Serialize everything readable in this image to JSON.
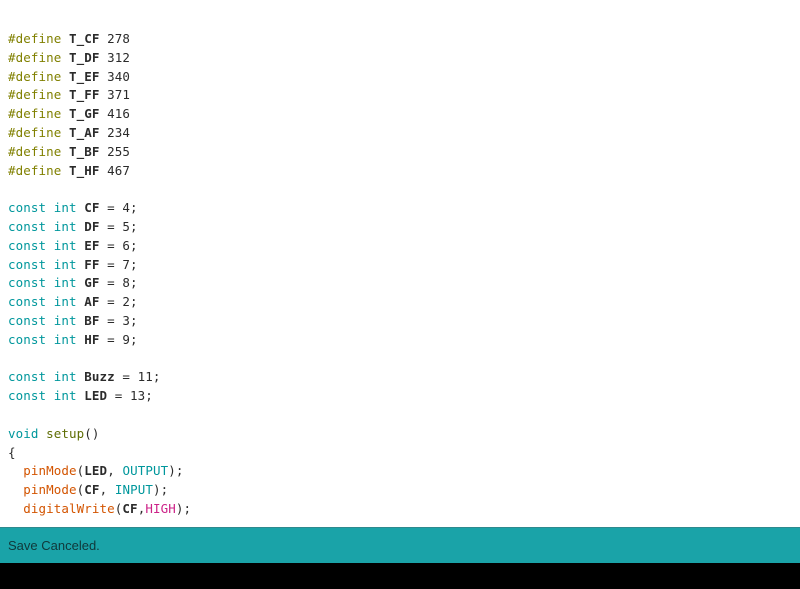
{
  "editor": {
    "background": "#ffffff",
    "font_size_px": 12.5,
    "code_lines": [
      {
        "id": "define-t-cf",
        "text": "#define T_CF 278",
        "tokens": [
          {
            "t": "#define",
            "c": "tok-preproc"
          },
          {
            "t": " ",
            "c": "tok-plain"
          },
          {
            "t": "T_CF",
            "c": "tok-ident"
          },
          {
            "t": " 278",
            "c": "tok-plain"
          }
        ]
      },
      {
        "id": "define-t-df",
        "text": "#define T_DF 312",
        "tokens": [
          {
            "t": "#define",
            "c": "tok-preproc"
          },
          {
            "t": " ",
            "c": "tok-plain"
          },
          {
            "t": "T_DF",
            "c": "tok-ident"
          },
          {
            "t": " 312",
            "c": "tok-plain"
          }
        ]
      },
      {
        "id": "define-t-ef",
        "text": "#define T_EF 340",
        "tokens": [
          {
            "t": "#define",
            "c": "tok-preproc"
          },
          {
            "t": " ",
            "c": "tok-plain"
          },
          {
            "t": "T_EF",
            "c": "tok-ident"
          },
          {
            "t": " 340",
            "c": "tok-plain"
          }
        ]
      },
      {
        "id": "define-t-ff",
        "text": "#define T_FF 371",
        "tokens": [
          {
            "t": "#define",
            "c": "tok-preproc"
          },
          {
            "t": " ",
            "c": "tok-plain"
          },
          {
            "t": "T_FF",
            "c": "tok-ident"
          },
          {
            "t": " 371",
            "c": "tok-plain"
          }
        ]
      },
      {
        "id": "define-t-gf",
        "text": "#define T_GF 416",
        "tokens": [
          {
            "t": "#define",
            "c": "tok-preproc"
          },
          {
            "t": " ",
            "c": "tok-plain"
          },
          {
            "t": "T_GF",
            "c": "tok-ident"
          },
          {
            "t": " 416",
            "c": "tok-plain"
          }
        ]
      },
      {
        "id": "define-t-af",
        "text": "#define T_AF 234",
        "tokens": [
          {
            "t": "#define",
            "c": "tok-preproc"
          },
          {
            "t": " ",
            "c": "tok-plain"
          },
          {
            "t": "T_AF",
            "c": "tok-ident"
          },
          {
            "t": " 234",
            "c": "tok-plain"
          }
        ]
      },
      {
        "id": "define-t-bf",
        "text": "#define T_BF 255",
        "tokens": [
          {
            "t": "#define",
            "c": "tok-preproc"
          },
          {
            "t": " ",
            "c": "tok-plain"
          },
          {
            "t": "T_BF",
            "c": "tok-ident"
          },
          {
            "t": " 255",
            "c": "tok-plain"
          }
        ]
      },
      {
        "id": "define-t-hf",
        "text": "#define T_HF 467",
        "tokens": [
          {
            "t": "#define",
            "c": "tok-preproc"
          },
          {
            "t": " ",
            "c": "tok-plain"
          },
          {
            "t": "T_HF",
            "c": "tok-ident"
          },
          {
            "t": " 467",
            "c": "tok-plain"
          }
        ]
      },
      {
        "id": "blank-1",
        "text": "",
        "tokens": []
      },
      {
        "id": "const-cf",
        "text": "const int CF = 4;",
        "tokens": [
          {
            "t": "const int",
            "c": "tok-keyword"
          },
          {
            "t": " ",
            "c": "tok-plain"
          },
          {
            "t": "CF",
            "c": "tok-ident"
          },
          {
            "t": " = 4;",
            "c": "tok-plain"
          }
        ]
      },
      {
        "id": "const-df",
        "text": "const int DF = 5;",
        "tokens": [
          {
            "t": "const int",
            "c": "tok-keyword"
          },
          {
            "t": " ",
            "c": "tok-plain"
          },
          {
            "t": "DF",
            "c": "tok-ident"
          },
          {
            "t": " = 5;",
            "c": "tok-plain"
          }
        ]
      },
      {
        "id": "const-ef",
        "text": "const int EF = 6;",
        "tokens": [
          {
            "t": "const int",
            "c": "tok-keyword"
          },
          {
            "t": " ",
            "c": "tok-plain"
          },
          {
            "t": "EF",
            "c": "tok-ident"
          },
          {
            "t": " = 6;",
            "c": "tok-plain"
          }
        ]
      },
      {
        "id": "const-ff",
        "text": "const int FF = 7;",
        "tokens": [
          {
            "t": "const int",
            "c": "tok-keyword"
          },
          {
            "t": " ",
            "c": "tok-plain"
          },
          {
            "t": "FF",
            "c": "tok-ident"
          },
          {
            "t": " = 7;",
            "c": "tok-plain"
          }
        ]
      },
      {
        "id": "const-gf",
        "text": "const int GF = 8;",
        "tokens": [
          {
            "t": "const int",
            "c": "tok-keyword"
          },
          {
            "t": " ",
            "c": "tok-plain"
          },
          {
            "t": "GF",
            "c": "tok-ident"
          },
          {
            "t": " = 8;",
            "c": "tok-plain"
          }
        ]
      },
      {
        "id": "const-af",
        "text": "const int AF = 2;",
        "tokens": [
          {
            "t": "const int",
            "c": "tok-keyword"
          },
          {
            "t": " ",
            "c": "tok-plain"
          },
          {
            "t": "AF",
            "c": "tok-ident"
          },
          {
            "t": " = 2;",
            "c": "tok-plain"
          }
        ]
      },
      {
        "id": "const-bf",
        "text": "const int BF = 3;",
        "tokens": [
          {
            "t": "const int",
            "c": "tok-keyword"
          },
          {
            "t": " ",
            "c": "tok-plain"
          },
          {
            "t": "BF",
            "c": "tok-ident"
          },
          {
            "t": " = 3;",
            "c": "tok-plain"
          }
        ]
      },
      {
        "id": "const-hf",
        "text": "const int HF = 9;",
        "tokens": [
          {
            "t": "const int",
            "c": "tok-keyword"
          },
          {
            "t": " ",
            "c": "tok-plain"
          },
          {
            "t": "HF",
            "c": "tok-ident"
          },
          {
            "t": " = 9;",
            "c": "tok-plain"
          }
        ]
      },
      {
        "id": "blank-2",
        "text": "",
        "tokens": []
      },
      {
        "id": "const-buzz",
        "text": "const int Buzz = 11;",
        "tokens": [
          {
            "t": "const int",
            "c": "tok-keyword"
          },
          {
            "t": " ",
            "c": "tok-plain"
          },
          {
            "t": "Buzz",
            "c": "tok-ident"
          },
          {
            "t": " = 11;",
            "c": "tok-plain"
          }
        ]
      },
      {
        "id": "const-led",
        "text": "const int LED = 13;",
        "tokens": [
          {
            "t": "const int",
            "c": "tok-keyword"
          },
          {
            "t": " ",
            "c": "tok-plain"
          },
          {
            "t": "LED",
            "c": "tok-ident"
          },
          {
            "t": " = 13;",
            "c": "tok-plain"
          }
        ]
      },
      {
        "id": "blank-3",
        "text": "",
        "tokens": []
      },
      {
        "id": "setup-signature",
        "text": "void setup()",
        "tokens": [
          {
            "t": "void",
            "c": "tok-keyword"
          },
          {
            "t": " ",
            "c": "tok-plain"
          },
          {
            "t": "setup",
            "c": "tok-setupname"
          },
          {
            "t": "()",
            "c": "tok-punct"
          }
        ]
      },
      {
        "id": "setup-open-brace",
        "text": "{",
        "tokens": [
          {
            "t": "{",
            "c": "tok-punct"
          }
        ]
      },
      {
        "id": "pinmode-led-output",
        "text": "  pinMode(LED, OUTPUT);",
        "tokens": [
          {
            "t": "  ",
            "c": "tok-plain"
          },
          {
            "t": "pinMode",
            "c": "tok-func"
          },
          {
            "t": "(",
            "c": "tok-punct"
          },
          {
            "t": "LED",
            "c": "tok-ident"
          },
          {
            "t": ", ",
            "c": "tok-plain"
          },
          {
            "t": "OUTPUT",
            "c": "tok-const"
          },
          {
            "t": ");",
            "c": "tok-punct"
          }
        ]
      },
      {
        "id": "pinmode-cf-input",
        "text": "  pinMode(CF, INPUT);",
        "tokens": [
          {
            "t": "  ",
            "c": "tok-plain"
          },
          {
            "t": "pinMode",
            "c": "tok-func"
          },
          {
            "t": "(",
            "c": "tok-punct"
          },
          {
            "t": "CF",
            "c": "tok-ident"
          },
          {
            "t": ", ",
            "c": "tok-plain"
          },
          {
            "t": "INPUT",
            "c": "tok-const"
          },
          {
            "t": ");",
            "c": "tok-punct"
          }
        ]
      },
      {
        "id": "digitalwrite-cf-high",
        "text": "  digitalWrite(CF,HIGH);",
        "tokens": [
          {
            "t": "  ",
            "c": "tok-plain"
          },
          {
            "t": "digitalWrite",
            "c": "tok-func"
          },
          {
            "t": "(",
            "c": "tok-punct"
          },
          {
            "t": "CF",
            "c": "tok-ident"
          },
          {
            "t": ",",
            "c": "tok-plain"
          },
          {
            "t": "HIGH",
            "c": "tok-literal"
          },
          {
            "t": ");",
            "c": "tok-punct"
          }
        ]
      }
    ]
  },
  "status_bar": {
    "message": "Save Canceled.",
    "background_color": "#1aa3a8",
    "text_color": "#10383a"
  },
  "console": {
    "background_color": "#000000",
    "text": ""
  }
}
